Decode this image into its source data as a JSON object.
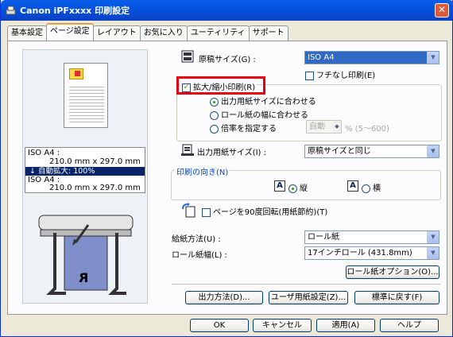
{
  "window": {
    "title": "Canon iPFxxxx 印刷設定",
    "close": "✕"
  },
  "tabs": [
    "基本設定",
    "ページ設定",
    "レイアウト",
    "お気に入り",
    "ユーティリティ",
    "サポート"
  ],
  "preview": {
    "original_label": "ISO A4 :",
    "original_size": "210.0 mm x 297.0 mm",
    "scale": "↓ 自動拡大: 100%",
    "output_label": "ISO A4 :",
    "output_size": "210.0 mm x 297.0 mm",
    "paper_letter": "R"
  },
  "page_size": {
    "label": "原稿サイズ(G) :",
    "value": "ISO A4"
  },
  "borderless": {
    "label": "フチなし印刷(E)",
    "checked": false
  },
  "scaling": {
    "label": "拡大/縮小印刷(R)",
    "checked": true
  },
  "scaling_options": [
    {
      "label": "出力用紙サイズに合わせる",
      "selected": true
    },
    {
      "label": "ロール紙の幅に合わせる",
      "selected": false
    },
    {
      "label": "倍率を指定する",
      "selected": false
    }
  ],
  "ratio": {
    "value": "自動",
    "range": "% (5〜600)"
  },
  "output_size": {
    "label": "出力用紙サイズ(I) :",
    "value": "原稿サイズと同じ"
  },
  "orientation": {
    "group": "印刷の向き(N)",
    "portrait": "縦",
    "landscape": "横",
    "portrait_selected": true
  },
  "rotate": {
    "label": "ページを90度回転(用紙節約)(T)",
    "checked": false
  },
  "paper_source": {
    "label": "給紙方法(U) :",
    "value": "ロール紙"
  },
  "roll_width": {
    "label": "ロール紙幅(L) :",
    "value": "17インチロール (431.8mm)"
  },
  "buttons": {
    "roll_options": "ロール紙オプション(O)...",
    "output_method": "出力方法(D)...",
    "custom_paper": "ユーザ用紙設定(Z)...",
    "defaults": "標準に戻す(F)",
    "ok": "OK",
    "cancel": "キャンセル",
    "apply": "適用(A)",
    "help": "ヘルプ"
  },
  "colors": {
    "accent": "#316ac5",
    "highlight": "#e60012"
  }
}
